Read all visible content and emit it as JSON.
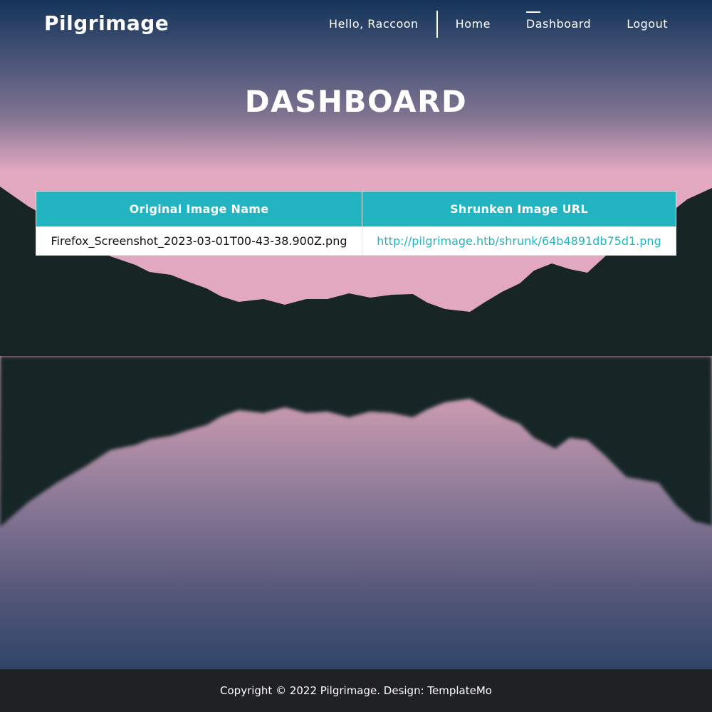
{
  "nav": {
    "brand": "Pilgrimage",
    "greeting": "Hello, Raccoon",
    "links": [
      {
        "label": "Home"
      },
      {
        "label": "Dashboard",
        "active": true
      },
      {
        "label": "Logout"
      }
    ]
  },
  "page": {
    "title": "DASHBOARD"
  },
  "table": {
    "headers": [
      "Original Image Name",
      "Shrunken Image URL"
    ],
    "rows": [
      {
        "name": "Firefox_Screenshot_2023-03-01T00-43-38.900Z.png",
        "url": "http://pilgrimage.htb/shrunk/64b4891db75d1.png"
      }
    ]
  },
  "footer": {
    "text": "Copyright © 2022 Pilgrimage. Design: TemplateMo"
  },
  "colors": {
    "accent": "#23b4c2",
    "footer_bg": "#202124",
    "mountain": "#182525"
  }
}
